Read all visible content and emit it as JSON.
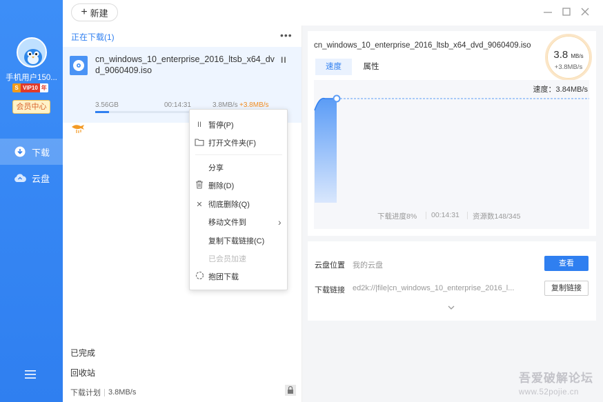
{
  "sidebar": {
    "username": "手机用户150...",
    "vip_badge": {
      "s": "S",
      "label": "VIP10",
      "year": "年"
    },
    "member_center": "会员中心",
    "nav": [
      {
        "label": "下载",
        "icon": "download-icon",
        "active": true
      },
      {
        "label": "云盘",
        "icon": "cloud-icon",
        "active": false
      }
    ],
    "menu_icon": "hamburger-menu-icon",
    "color": "#2f7ff0"
  },
  "toolbar": {
    "new_label": "新建"
  },
  "window_controls": [
    "minimize-icon",
    "maximize-icon",
    "close-icon"
  ],
  "list": {
    "header": "正在下载(1)",
    "more": "•••",
    "task": {
      "name": "cn_windows_10_enterprise_2016_ltsb_x64_dvd_9060409.iso",
      "size": "3.56GB",
      "time_left": "00:14:31",
      "speed": "3.8MB/s",
      "boost": "+3.8MB/s",
      "progress_percent": 8,
      "pause_glyph": "II"
    },
    "completed": "已完成",
    "recycle": "回收站",
    "plan_label": "下载计划",
    "plan_speed": "3.8MB/s"
  },
  "context_menu": {
    "items": [
      {
        "label": "暂停(P)",
        "icon": "pause-icon",
        "glyph": "II",
        "disabled": false
      },
      {
        "label": "打开文件夹(F)",
        "icon": "folder-icon",
        "glyph": "",
        "disabled": false
      },
      {
        "label": "分享",
        "icon": "",
        "glyph": "",
        "disabled": false
      },
      {
        "label": "删除(D)",
        "icon": "trash-icon",
        "glyph": "",
        "disabled": false
      },
      {
        "label": "彻底删除(Q)",
        "icon": "x-icon",
        "glyph": "✕",
        "disabled": false
      },
      {
        "label": "移动文件到",
        "icon": "chevron-right-icon",
        "glyph": "›",
        "disabled": false
      },
      {
        "label": "复制下载链接(C)",
        "icon": "",
        "glyph": "",
        "disabled": false
      },
      {
        "label": "已会员加速",
        "icon": "",
        "glyph": "",
        "disabled": true
      },
      {
        "label": "抱团下载",
        "icon": "group-download-icon",
        "glyph": "",
        "disabled": false
      }
    ]
  },
  "detail": {
    "title": "cn_windows_10_enterprise_2016_ltsb_x64_dvd_9060409.iso",
    "tabs": [
      "速度",
      "属性"
    ],
    "speed_value": "3.8",
    "speed_unit": "MB/s",
    "speed_boost": "+3.8MB/s",
    "chart_speed_label": "速度：3.84MB/s",
    "progress_text": "下载进度8%",
    "time_left": "00:14:31",
    "sources": "资源数148/345",
    "accent": "#2f7ff0"
  },
  "info": {
    "cloud_label": "云盘位置",
    "cloud_value": "我的云盘",
    "view_button": "查看",
    "link_label": "下载链接",
    "link_value": "ed2k://|file|cn_windows_10_enterprise_2016_l...",
    "copy_button": "复制链接"
  },
  "watermark": {
    "line1": "吾爱破解论坛",
    "line2": "www.52pojie.cn"
  }
}
